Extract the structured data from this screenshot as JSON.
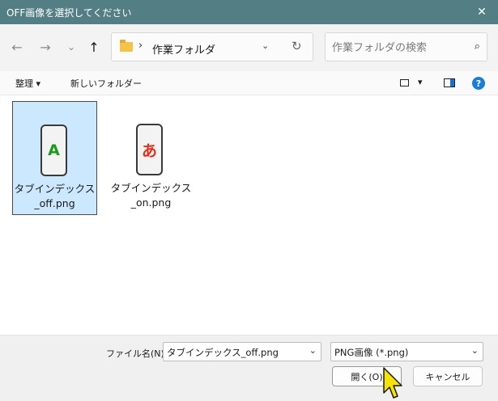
{
  "window": {
    "title": "OFF画像を選択してください",
    "close_glyph": "✕"
  },
  "nav": {
    "back_glyph": "←",
    "forward_glyph": "→",
    "recent_glyph": "⌄",
    "up_glyph": "↑",
    "address_sep": "›",
    "address_path": "作業フォルダ",
    "address_dropdown_glyph": "⌄",
    "refresh_glyph": "↻",
    "search_placeholder": "作業フォルダの検索",
    "search_glyph": "⌕"
  },
  "toolbar": {
    "organize_label": "整理 ▾",
    "new_folder_label": "新しいフォルダー",
    "view_dropdown_glyph": "▾",
    "help_glyph": "?"
  },
  "files": [
    {
      "glyph": "A",
      "glyph_color": "#1a9b1a",
      "name_line1": "タブインデックス",
      "name_line2": "_off.png",
      "selected": true
    },
    {
      "glyph": "あ",
      "glyph_color": "#e0301e",
      "name_line1": "タブインデックス",
      "name_line2": "_on.png",
      "selected": false
    }
  ],
  "bottom": {
    "filename_label": "ファイル名(N):",
    "filename_value": "タブインデックス_off.png",
    "filetype_value": "PNG画像 (*.png)",
    "combo_arrow": "⌄",
    "open_label": "開く(O)",
    "cancel_label": "キャンセル"
  },
  "colors": {
    "titlebar": "#527e84",
    "selection": "#cce8ff",
    "accent": "#1b7dd8"
  }
}
